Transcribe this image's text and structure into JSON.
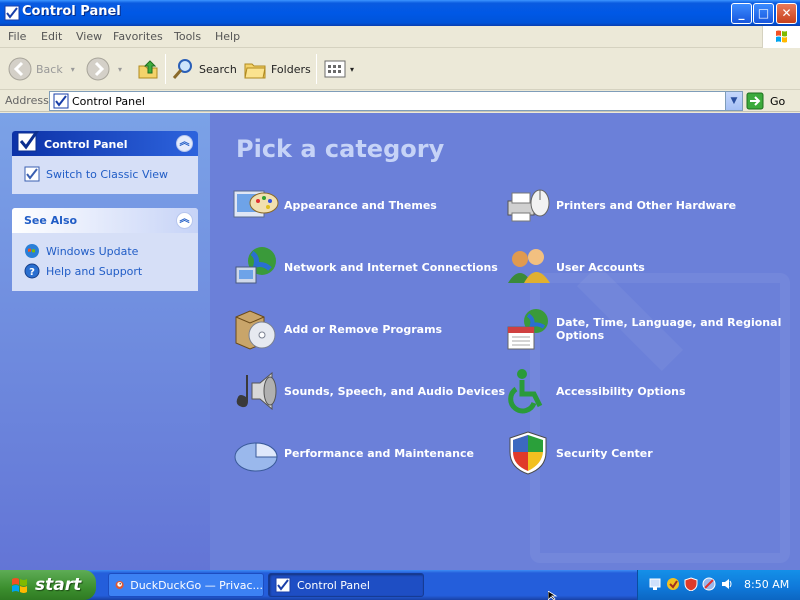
{
  "window": {
    "title": "Control Panel",
    "buttons": {
      "minimize": "_",
      "maximize": "□",
      "close": "✕"
    }
  },
  "menubar": {
    "items": [
      "File",
      "Edit",
      "View",
      "Favorites",
      "Tools",
      "Help"
    ]
  },
  "toolbar": {
    "back": "Back",
    "search": "Search",
    "folders": "Folders"
  },
  "address": {
    "label": "Address",
    "value": "Control Panel",
    "go": "Go"
  },
  "left_pane": {
    "control_panel": {
      "title": "Control Panel",
      "items": [
        {
          "label": "Switch to Classic View",
          "icon": "classic-view-icon"
        }
      ]
    },
    "see_also": {
      "title": "See Also",
      "items": [
        {
          "label": "Windows Update",
          "icon": "windows-update-icon"
        },
        {
          "label": "Help and Support",
          "icon": "help-icon"
        }
      ]
    }
  },
  "main": {
    "heading": "Pick a category",
    "categories": [
      {
        "label": "Appearance and Themes",
        "icon": "appearance-themes-icon"
      },
      {
        "label": "Printers and Other Hardware",
        "icon": "printers-hardware-icon"
      },
      {
        "label": "Network and Internet Connections",
        "icon": "network-internet-icon"
      },
      {
        "label": "User Accounts",
        "icon": "user-accounts-icon"
      },
      {
        "label": "Add or Remove Programs",
        "icon": "add-remove-programs-icon"
      },
      {
        "label": "Date, Time, Language, and Regional Options",
        "icon": "date-time-regional-icon"
      },
      {
        "label": "Sounds, Speech, and Audio Devices",
        "icon": "sounds-audio-icon"
      },
      {
        "label": "Accessibility Options",
        "icon": "accessibility-icon"
      },
      {
        "label": "Performance and Maintenance",
        "icon": "performance-maintenance-icon"
      },
      {
        "label": "Security Center",
        "icon": "security-center-icon"
      }
    ]
  },
  "taskbar": {
    "start": "start",
    "tasks": [
      {
        "label": "DuckDuckGo — Privac...",
        "icon": "duckduckgo-icon"
      },
      {
        "label": "Control Panel",
        "icon": "control-panel-icon"
      }
    ],
    "clock": "8:50 AM"
  },
  "colors": {
    "titlebar": "#0058e6",
    "main_bg": "#6b80d9",
    "heading": "#c6d3f7",
    "link": "#215dc6",
    "start_green": "#3c8f2e"
  }
}
